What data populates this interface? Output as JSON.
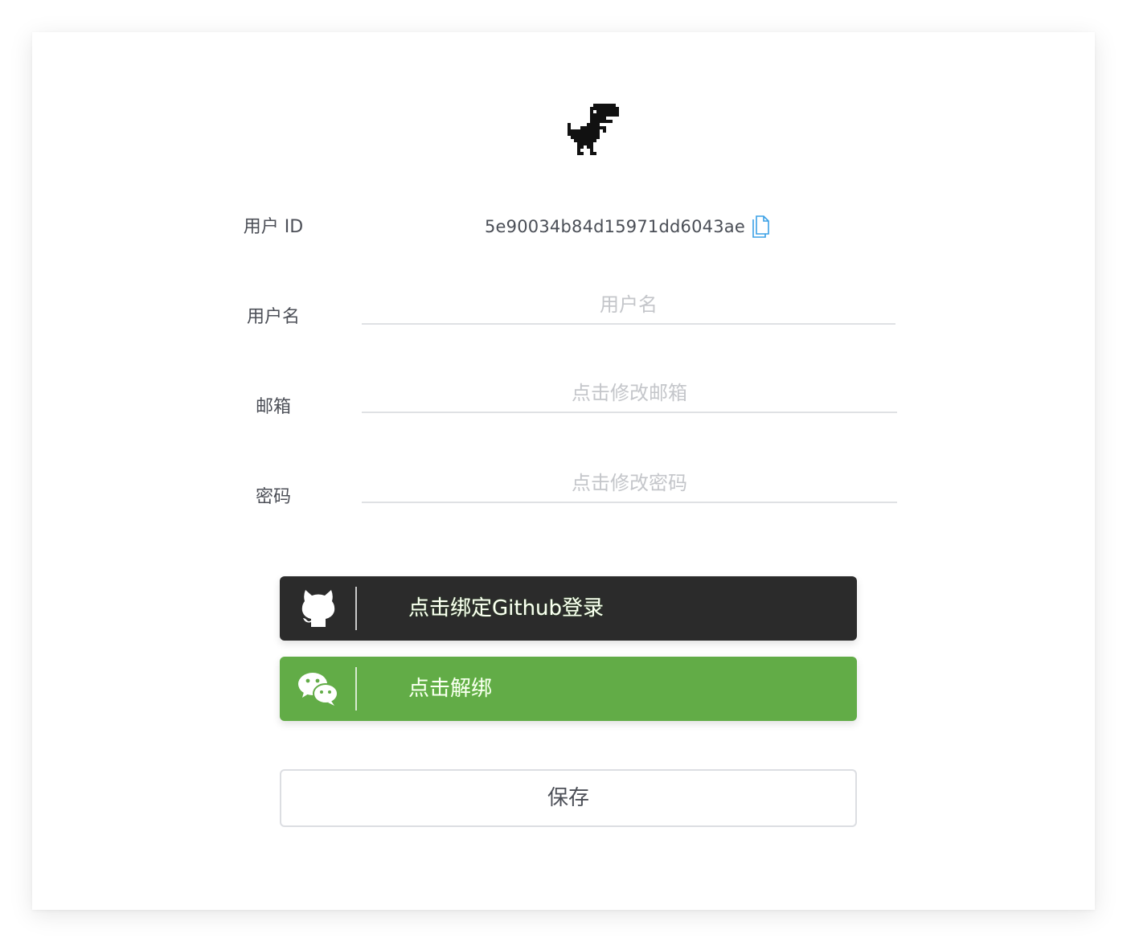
{
  "profile": {
    "avatar_icon": "dinosaur-avatar-icon",
    "user_id_label": "用户 ID",
    "user_id_value": "5e90034b84d15971dd6043ae",
    "copy_icon": "copy-icon",
    "username_label": "用户名",
    "username_value": "",
    "username_placeholder": "用户名",
    "email_label": "邮箱",
    "email_value": "",
    "email_placeholder": "点击修改邮箱",
    "password_label": "密码",
    "password_value": "",
    "password_placeholder": "点击修改密码"
  },
  "bindings": {
    "github": {
      "icon": "github-icon",
      "label": "点击绑定Github登录",
      "color": "#2b2b2b"
    },
    "wechat": {
      "icon": "wechat-icon",
      "label": "点击解绑",
      "color": "#62ac47"
    }
  },
  "actions": {
    "save_label": "保存"
  },
  "colors": {
    "accent_copy": "#3aa0e6",
    "text": "#4c4f57",
    "placeholder": "#c4c6ca"
  }
}
